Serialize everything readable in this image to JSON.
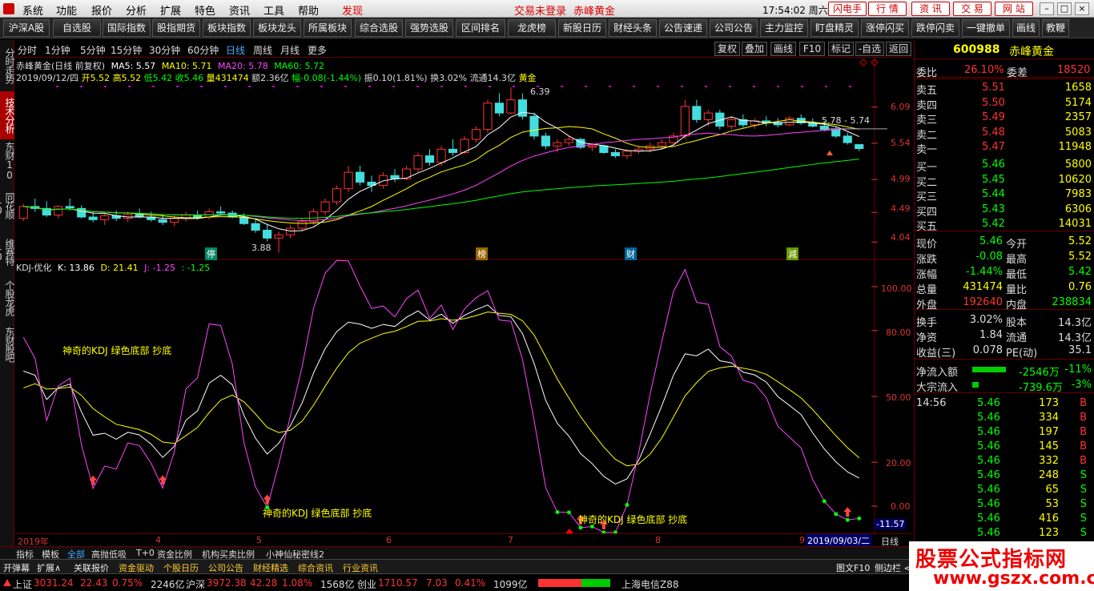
{
  "menu": {
    "items": [
      "系统",
      "功能",
      "报价",
      "分析",
      "扩展",
      "特色",
      "资讯",
      "工具",
      "帮助"
    ],
    "discover": "发现",
    "login_status": "交易未登录",
    "stock_name": "赤峰黄金",
    "clock": "17:54:02 周六",
    "buttons": [
      "闪电手",
      "行 情",
      "资 讯",
      "交 易",
      "网 站"
    ]
  },
  "toolbar": {
    "items": [
      "沪深A股",
      "自选股",
      "国际指数",
      "股指期货",
      "板块指数",
      "板块龙头",
      "所属板块",
      "综合选股",
      "强势选股",
      "区间排名",
      "龙虎榜",
      "新股日历",
      "财经头条",
      "公告速递",
      "公司公告",
      "主力监控",
      "盯盘精灵",
      "涨停闪买",
      "跌停闪卖",
      "一键撤单",
      "画线",
      "教鞭"
    ]
  },
  "left_rail": [
    "分时走势",
    "技术分析",
    "东财10",
    "同花顺10",
    "维赛特10",
    "个股龙虎",
    "东财股吧"
  ],
  "timeframes": [
    "分时",
    "1分钟",
    "5分钟",
    "15分钟",
    "30分钟",
    "60分钟",
    "日线",
    "周线",
    "月线",
    "更多"
  ],
  "timeframes_selected": "日线",
  "chart_tools": [
    "复权",
    "叠加",
    "画线",
    "F10",
    "标记",
    "-自选",
    "返回"
  ],
  "main_chart": {
    "title": "赤峰黄金(日线 前复权)",
    "ma": [
      {
        "label": "MA5: 5.57",
        "color": "#ffffff"
      },
      {
        "label": "MA10: 5.71",
        "color": "#ffff00"
      },
      {
        "label": "MA20: 5.78",
        "color": "#ff44ff"
      },
      {
        "label": "MA60: 5.72",
        "color": "#00ff00"
      }
    ],
    "info_date": "2019/09/12/四",
    "info_items": [
      {
        "t": "开5.52",
        "c": "#ffff00"
      },
      {
        "t": "高5.52",
        "c": "#ffff00"
      },
      {
        "t": "低5.42",
        "c": "#00ff00"
      },
      {
        "t": "收5.46",
        "c": "#00ff00"
      },
      {
        "t": "量431474",
        "c": "#ffff00"
      },
      {
        "t": "额2.36亿",
        "c": "#ddd"
      },
      {
        "t": "幅-0.08(-1.44%)",
        "c": "#00ff00"
      },
      {
        "t": "振0.10(1.81%)",
        "c": "#ddd"
      },
      {
        "t": "换3.02%",
        "c": "#ddd"
      },
      {
        "t": "流通14.3亿",
        "c": "#ddd"
      },
      {
        "t": "黄金",
        "c": "#ffff00"
      }
    ],
    "y_ticks": [
      "6.09",
      "5.54",
      "4.99",
      "4.49",
      "4.04"
    ],
    "annotations": {
      "high": "6.39",
      "low": "3.88",
      "range": "5.78 - 5.74"
    },
    "event_marks": [
      "停",
      "榜",
      "财",
      "減"
    ]
  },
  "kdj": {
    "title": "KDJ-优化",
    "k": "K: 13.86",
    "d": "D: 21.41",
    "j": "J: -1.25",
    "extra": ": -1.25",
    "y_ticks": [
      "100.00",
      "80.00",
      "50.00",
      "20.00",
      "0.00",
      "-11.57"
    ],
    "notes": [
      "神奇的KDJ 绿色底部 抄底",
      "神奇的KDJ 绿色底部 抄底",
      "神奇的KDJ 绿色底部 抄底"
    ]
  },
  "x_axis": {
    "labels": [
      "2019年",
      "4",
      "5",
      "6",
      "7",
      "8",
      "9"
    ],
    "cursor_date": "2019/09/03/二",
    "mode": "日线"
  },
  "chart_data": {
    "type": "candlestick",
    "ylim": [
      3.8,
      6.5
    ],
    "y_ticks": [
      6.09,
      5.54,
      4.99,
      4.49,
      4.04
    ],
    "candles": [
      [
        4.4,
        4.62,
        4.36,
        4.58
      ],
      [
        4.58,
        4.7,
        4.5,
        4.55
      ],
      [
        4.55,
        4.66,
        4.42,
        4.45
      ],
      [
        4.45,
        4.6,
        4.4,
        4.58
      ],
      [
        4.58,
        4.7,
        4.52,
        4.56
      ],
      [
        4.55,
        4.6,
        4.4,
        4.42
      ],
      [
        4.42,
        4.5,
        4.34,
        4.38
      ],
      [
        4.38,
        4.48,
        4.3,
        4.44
      ],
      [
        4.44,
        4.52,
        4.36,
        4.4
      ],
      [
        4.4,
        4.5,
        4.34,
        4.46
      ],
      [
        4.46,
        4.55,
        4.4,
        4.42
      ],
      [
        4.42,
        4.5,
        4.35,
        4.38
      ],
      [
        4.38,
        4.46,
        4.3,
        4.34
      ],
      [
        4.34,
        4.44,
        4.28,
        4.4
      ],
      [
        4.4,
        4.5,
        4.35,
        4.45
      ],
      [
        4.45,
        4.52,
        4.38,
        4.42
      ],
      [
        4.42,
        4.55,
        4.38,
        4.5
      ],
      [
        4.5,
        4.58,
        4.44,
        4.48
      ],
      [
        4.48,
        4.52,
        4.4,
        4.42
      ],
      [
        4.42,
        4.48,
        4.3,
        4.32
      ],
      [
        4.32,
        4.4,
        4.18,
        4.22
      ],
      [
        4.22,
        4.3,
        4.05,
        4.1
      ],
      [
        4.1,
        4.2,
        3.88,
        4.15
      ],
      [
        4.15,
        4.3,
        4.1,
        4.25
      ],
      [
        4.25,
        4.4,
        4.2,
        4.35
      ],
      [
        4.35,
        4.55,
        4.3,
        4.5
      ],
      [
        4.5,
        4.7,
        4.45,
        4.65
      ],
      [
        4.65,
        4.9,
        4.6,
        4.85
      ],
      [
        4.85,
        5.2,
        4.8,
        5.1
      ],
      [
        5.1,
        5.2,
        4.9,
        4.95
      ],
      [
        4.95,
        5.05,
        4.8,
        4.9
      ],
      [
        4.9,
        5.1,
        4.85,
        5.05
      ],
      [
        5.05,
        5.15,
        4.95,
        5.0
      ],
      [
        5.0,
        5.2,
        4.98,
        5.15
      ],
      [
        5.15,
        5.4,
        5.1,
        5.35
      ],
      [
        5.35,
        5.45,
        5.2,
        5.25
      ],
      [
        5.25,
        5.5,
        5.2,
        5.45
      ],
      [
        5.45,
        5.6,
        5.35,
        5.4
      ],
      [
        5.4,
        5.65,
        5.38,
        5.6
      ],
      [
        5.6,
        5.8,
        5.55,
        5.75
      ],
      [
        5.75,
        6.2,
        5.7,
        6.15
      ],
      [
        6.15,
        6.3,
        5.95,
        6.0
      ],
      [
        6.0,
        6.39,
        5.98,
        6.2
      ],
      [
        6.2,
        6.3,
        5.9,
        5.95
      ],
      [
        5.95,
        6.0,
        5.6,
        5.65
      ],
      [
        5.65,
        5.7,
        5.45,
        5.5
      ],
      [
        5.5,
        5.6,
        5.4,
        5.55
      ],
      [
        5.55,
        5.65,
        5.5,
        5.6
      ],
      [
        5.6,
        5.62,
        5.45,
        5.48
      ],
      [
        5.48,
        5.55,
        5.42,
        5.5
      ],
      [
        5.5,
        5.52,
        5.38,
        5.4
      ],
      [
        5.4,
        5.45,
        5.32,
        5.35
      ],
      [
        5.35,
        5.45,
        5.3,
        5.42
      ],
      [
        5.42,
        5.5,
        5.38,
        5.45
      ],
      [
        5.45,
        5.55,
        5.4,
        5.5
      ],
      [
        5.5,
        5.6,
        5.45,
        5.55
      ],
      [
        5.55,
        5.7,
        5.5,
        5.65
      ],
      [
        5.65,
        6.2,
        5.6,
        6.1
      ],
      [
        6.1,
        6.2,
        5.85,
        5.9
      ],
      [
        5.9,
        6.05,
        5.8,
        6.0
      ],
      [
        6.0,
        6.05,
        5.75,
        5.8
      ],
      [
        5.8,
        5.95,
        5.75,
        5.9
      ],
      [
        5.9,
        5.98,
        5.78,
        5.82
      ],
      [
        5.82,
        5.92,
        5.76,
        5.88
      ],
      [
        5.88,
        5.95,
        5.8,
        5.85
      ],
      [
        5.85,
        5.92,
        5.78,
        5.82
      ],
      [
        5.82,
        5.95,
        5.8,
        5.92
      ],
      [
        5.92,
        5.98,
        5.82,
        5.85
      ],
      [
        5.85,
        5.92,
        5.78,
        5.8
      ],
      [
        5.8,
        5.88,
        5.72,
        5.75
      ],
      [
        5.75,
        5.8,
        5.62,
        5.65
      ],
      [
        5.65,
        5.7,
        5.52,
        5.55
      ],
      [
        5.52,
        5.52,
        5.42,
        5.46
      ]
    ],
    "kdj_series": [
      {
        "name": "K",
        "color": "#ffffff"
      },
      {
        "name": "D",
        "color": "#ffff00"
      },
      {
        "name": "J",
        "color": "#ff44ff"
      }
    ]
  },
  "quote": {
    "code": "600988",
    "name": "赤峰黄金",
    "wb_label": "委比",
    "wb": "26.10%",
    "wc_label": "委差",
    "wc": "18520",
    "asks": [
      {
        "l": "卖五",
        "p": "5.51",
        "v": "1658"
      },
      {
        "l": "卖四",
        "p": "5.50",
        "v": "5174"
      },
      {
        "l": "卖三",
        "p": "5.49",
        "v": "2357"
      },
      {
        "l": "卖二",
        "p": "5.48",
        "v": "5083"
      },
      {
        "l": "卖一",
        "p": "5.47",
        "v": "11948"
      }
    ],
    "bids": [
      {
        "l": "买一",
        "p": "5.46",
        "v": "5800"
      },
      {
        "l": "买二",
        "p": "5.45",
        "v": "10620"
      },
      {
        "l": "买三",
        "p": "5.44",
        "v": "7983"
      },
      {
        "l": "买四",
        "p": "5.43",
        "v": "6306"
      },
      {
        "l": "买五",
        "p": "5.42",
        "v": "14031"
      }
    ],
    "stats": [
      {
        "l1": "现价",
        "v1": "5.46",
        "c1": "#00ff00",
        "l2": "今开",
        "v2": "5.52",
        "c2": "#ffff00"
      },
      {
        "l1": "涨跌",
        "v1": "-0.08",
        "c1": "#00ff00",
        "l2": "最高",
        "v2": "5.52",
        "c2": "#ffff00"
      },
      {
        "l1": "涨幅",
        "v1": "-1.44%",
        "c1": "#00ff00",
        "l2": "最低",
        "v2": "5.42",
        "c2": "#00ff00"
      },
      {
        "l1": "总量",
        "v1": "431474",
        "c1": "#ffff00",
        "l2": "量比",
        "v2": "0.76",
        "c2": "#ffff00"
      },
      {
        "l1": "外盘",
        "v1": "192640",
        "c1": "#ff3333",
        "l2": "内盘",
        "v2": "238834",
        "c2": "#00ff00"
      }
    ],
    "stats2": [
      {
        "l1": "换手",
        "v1": "3.02%",
        "l2": "股本",
        "v2": "14.3亿"
      },
      {
        "l1": "净资",
        "v1": "1.84",
        "l2": "流通",
        "v2": "14.3亿"
      },
      {
        "l1": "收益(三)",
        "v1": "0.078",
        "l2": "PE(动)",
        "v2": "35.1"
      }
    ],
    "flow": [
      {
        "l": "净流入额",
        "v": "-2546万",
        "p": "-11%",
        "bar": 0.8
      },
      {
        "l": "大宗流入",
        "v": "-739.6万",
        "p": "-3%",
        "bar": 0.15
      }
    ],
    "ticks": [
      {
        "t": "14:56",
        "p": "5.46",
        "v": "173",
        "s": "B"
      },
      {
        "t": "",
        "p": "5.46",
        "v": "334",
        "s": "B"
      },
      {
        "t": "",
        "p": "5.46",
        "v": "197",
        "s": "B"
      },
      {
        "t": "",
        "p": "5.46",
        "v": "145",
        "s": "B"
      },
      {
        "t": "",
        "p": "5.46",
        "v": "332",
        "s": "B"
      },
      {
        "t": "",
        "p": "5.46",
        "v": "248",
        "s": "S"
      },
      {
        "t": "",
        "p": "5.46",
        "v": "65",
        "s": "S"
      },
      {
        "t": "",
        "p": "5.46",
        "v": "53",
        "s": "S"
      },
      {
        "t": "",
        "p": "5.46",
        "v": "416",
        "s": "S"
      },
      {
        "t": "",
        "p": "5.46",
        "v": "123",
        "s": "S"
      }
    ]
  },
  "bottom_tabs": [
    "指标",
    "模板",
    "全部",
    "高抛低吸",
    "T+0",
    "资金比例",
    "机构买卖比例",
    "小神仙秘密线2"
  ],
  "bottom_tabs_selected": "全部",
  "bottom2": [
    "开弹幕",
    "扩展∧",
    "关联报价",
    "资金驱动",
    "个股日历",
    "公司公告",
    "财经精选",
    "综合资讯",
    "行业资讯"
  ],
  "bottom2_right": [
    "图文F10",
    "侧边栏 <"
  ],
  "status": {
    "sh_label": "上证",
    "sh": "3031.24",
    "sh_chg": "22.43",
    "sh_pct": "0.75%",
    "sh_amt": "2246亿",
    "hs_label": "沪深",
    "hs": "3972.38",
    "hs_chg": "42.28",
    "hs_pct": "1.08%",
    "hs_amt": "1568亿",
    "cy_label": "创业",
    "cy": "1710.57",
    "cy_chg": "7.03",
    "cy_pct": "0.41%",
    "cy_amt": "1099亿",
    "server": "上海电信Z88"
  },
  "watermark": {
    "line1": "股票公式指标网",
    "line2": "www.gszx.com.cn"
  }
}
